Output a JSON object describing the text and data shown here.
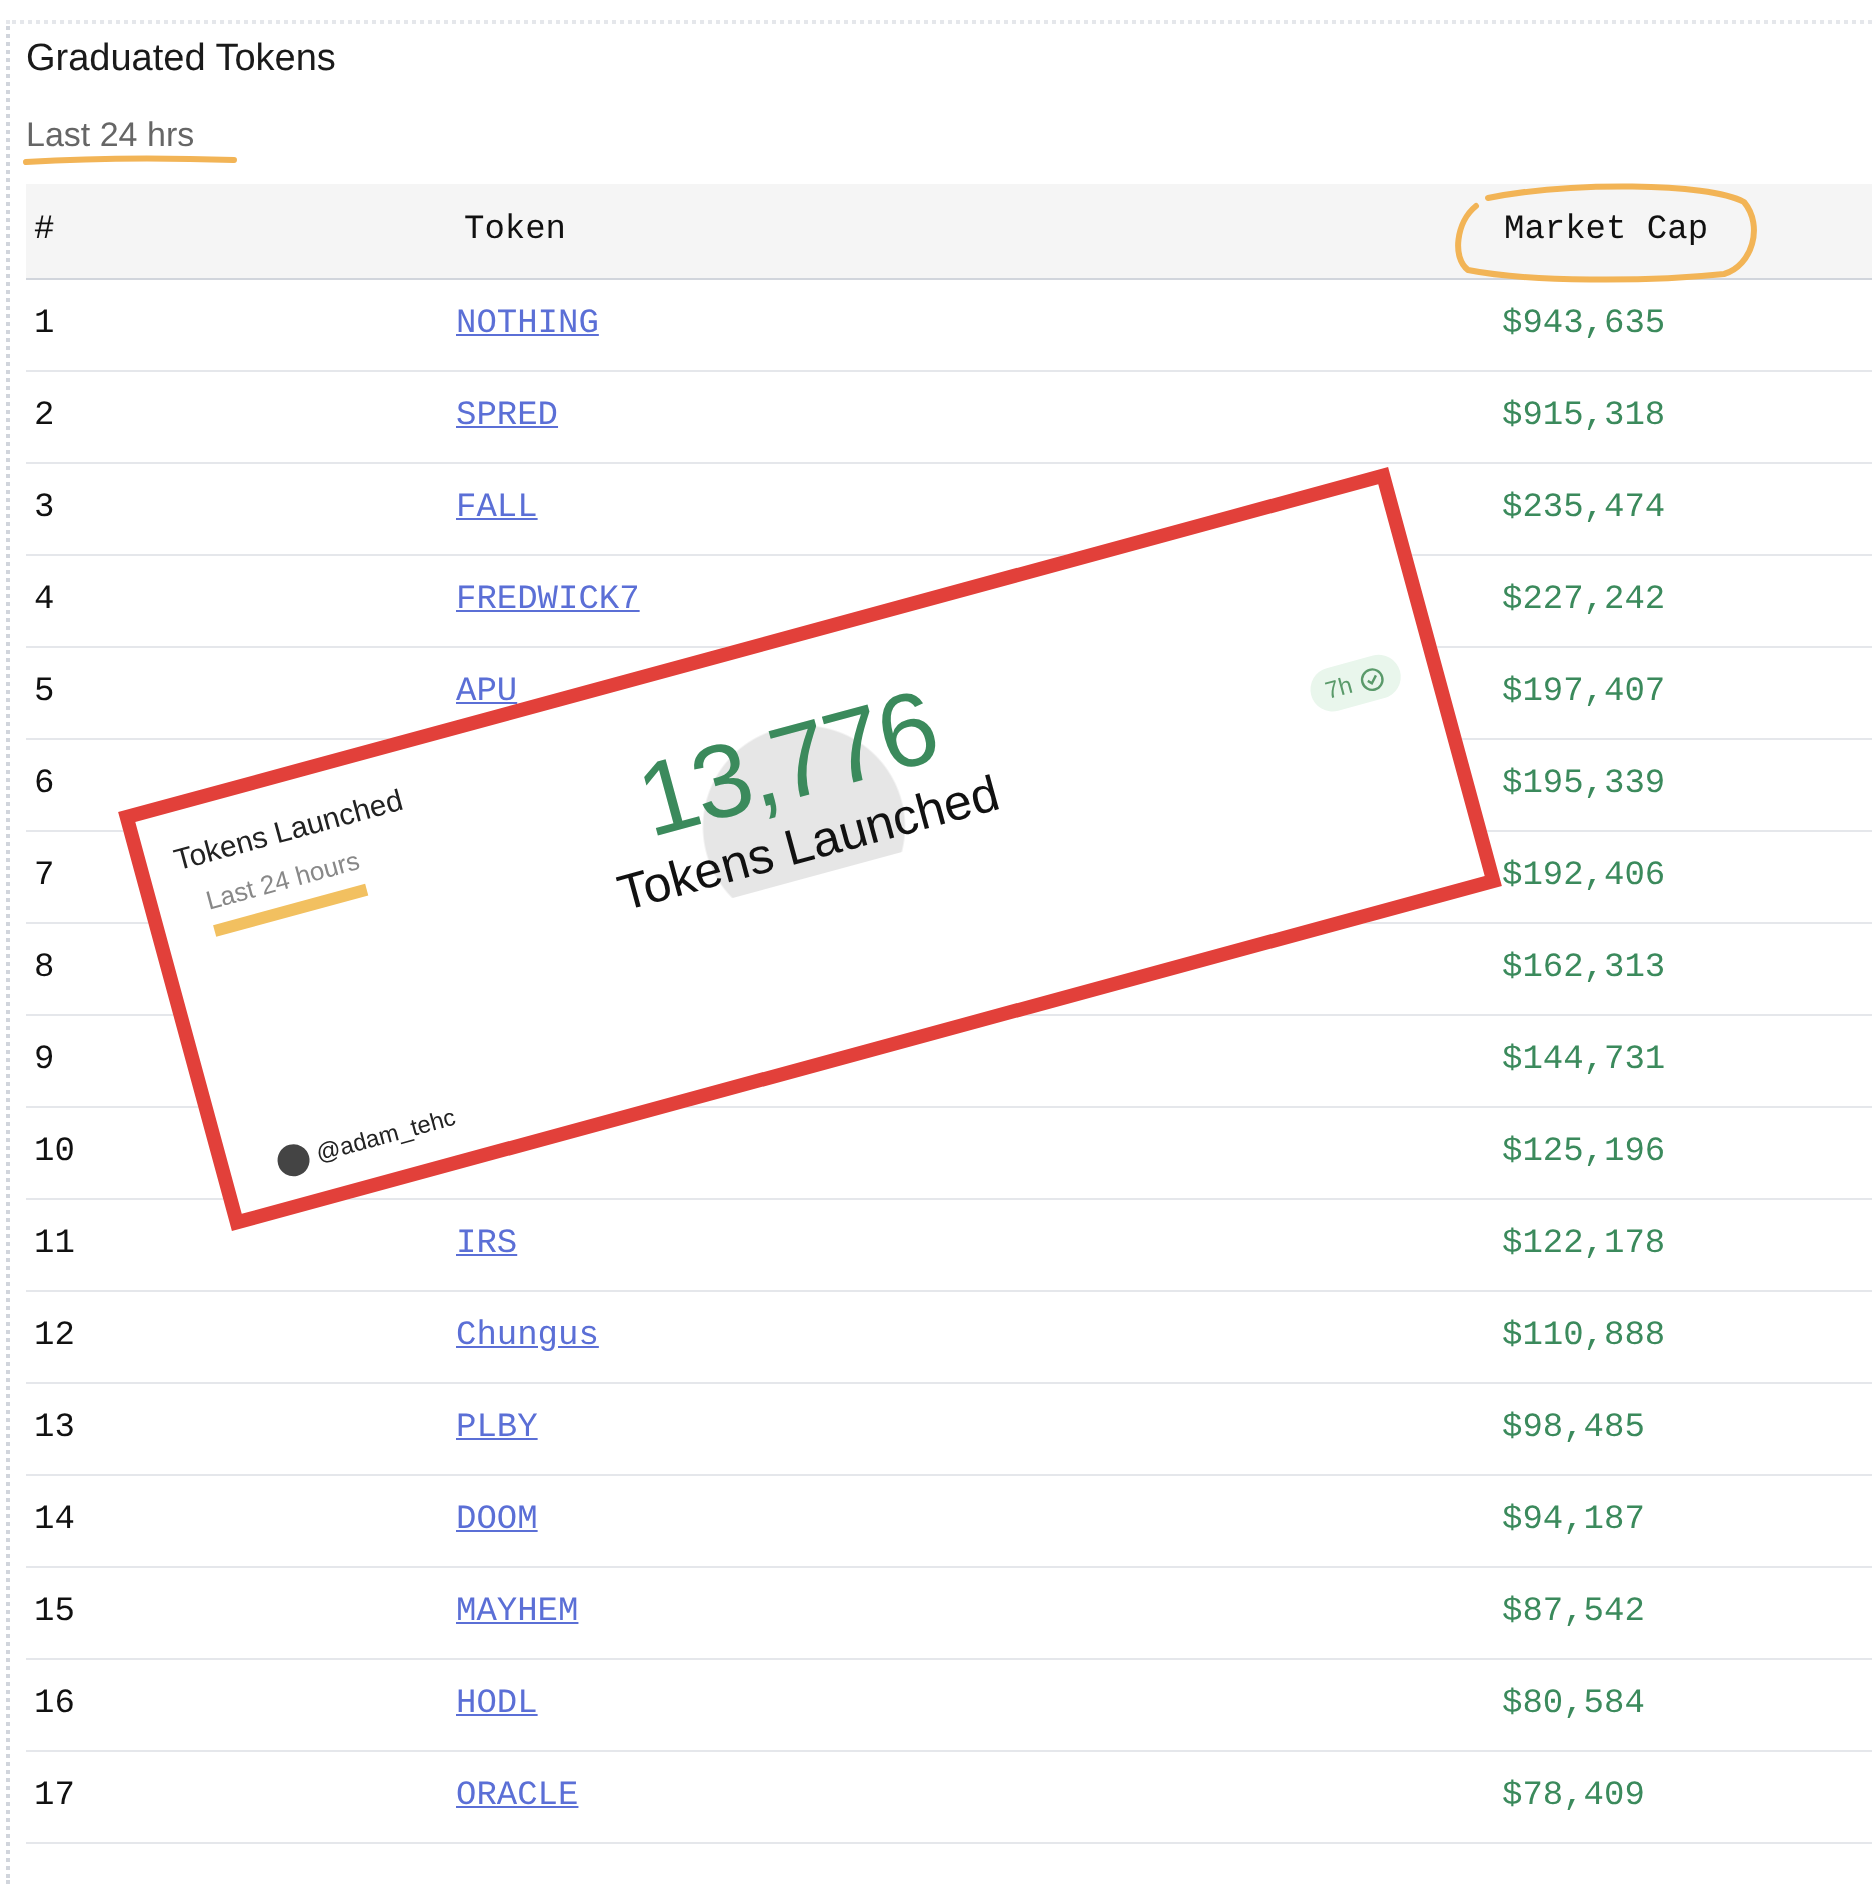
{
  "title": "Graduated Tokens",
  "subtitle": "Last 24 hrs",
  "table": {
    "columns": [
      "#",
      "Token",
      "Market Cap"
    ],
    "rows": [
      {
        "rank": "1",
        "token": "NOTHING",
        "market_cap": "$943,635"
      },
      {
        "rank": "2",
        "token": "SPRED",
        "market_cap": "$915,318"
      },
      {
        "rank": "3",
        "token": "FALL",
        "market_cap": "$235,474"
      },
      {
        "rank": "4",
        "token": "FREDWICK7",
        "market_cap": "$227,242"
      },
      {
        "rank": "5",
        "token": "APU",
        "market_cap": "$197,407"
      },
      {
        "rank": "6",
        "market_cap": "$195,339"
      },
      {
        "rank": "7",
        "market_cap": "$192,406"
      },
      {
        "rank": "8",
        "market_cap": "$162,313"
      },
      {
        "rank": "9",
        "market_cap": "$144,731"
      },
      {
        "rank": "10",
        "market_cap": "$125,196"
      },
      {
        "rank": "11",
        "token": "IRS",
        "market_cap": "$122,178"
      },
      {
        "rank": "12",
        "token": "Chungus",
        "market_cap": "$110,888"
      },
      {
        "rank": "13",
        "token": "PLBY",
        "market_cap": "$98,485"
      },
      {
        "rank": "14",
        "token": "DOOM",
        "market_cap": "$94,187"
      },
      {
        "rank": "15",
        "token": "MAYHEM",
        "market_cap": "$87,542"
      },
      {
        "rank": "16",
        "token": "HODL",
        "market_cap": "$80,584"
      },
      {
        "rank": "17",
        "token": "ORACLE",
        "market_cap": "$78,409"
      }
    ]
  },
  "overlay_card": {
    "title": "Tokens Launched",
    "subtitle": "Last 24 hours",
    "count": "13,776",
    "count_label": "Tokens Launched",
    "badge": "7h",
    "author": "@adam_tehc"
  }
}
